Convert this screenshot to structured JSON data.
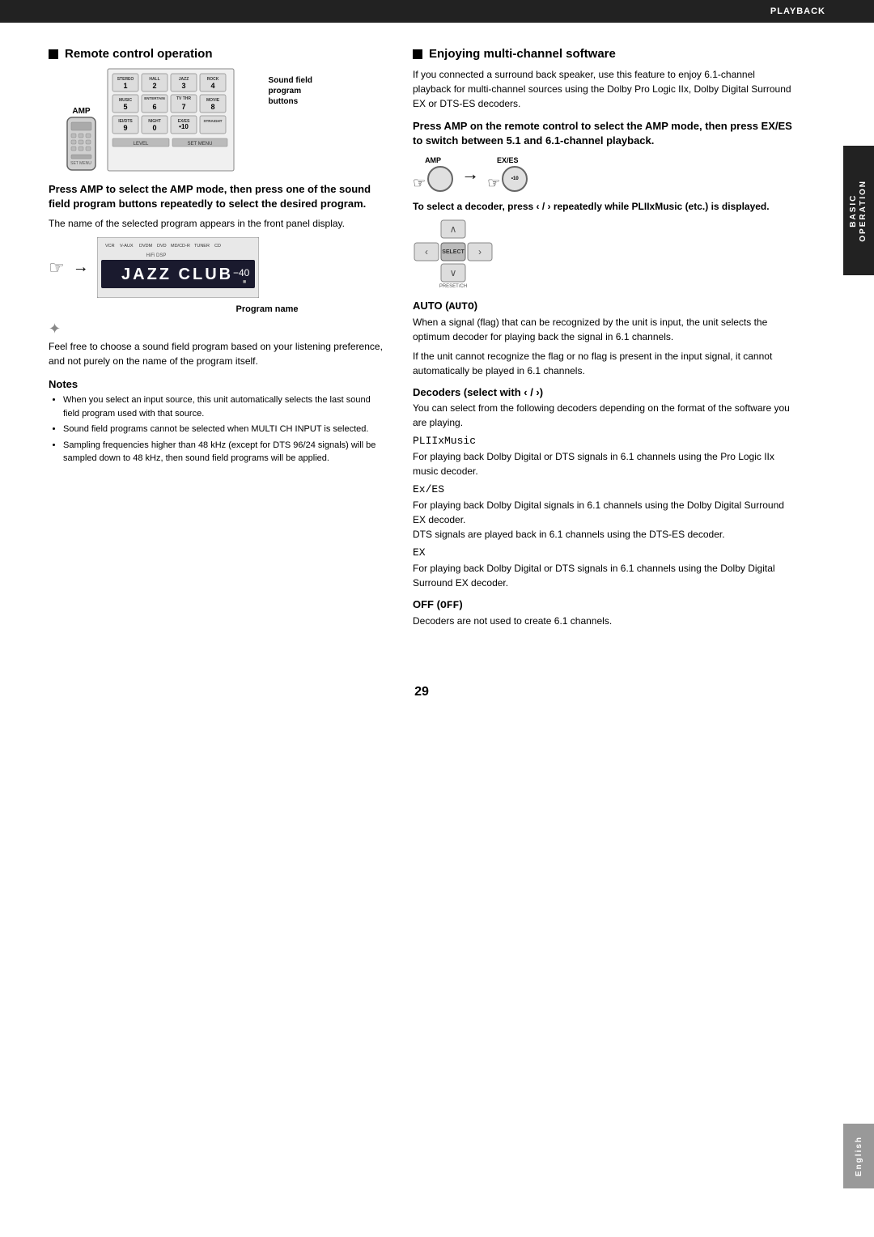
{
  "page": {
    "number": "29",
    "section_tab": "PLAYBACK",
    "right_tab_lines": [
      "BASIC",
      "OPERATION"
    ],
    "bottom_tab": "English"
  },
  "left_section": {
    "title": "Remote control operation",
    "amp_label": "AMP",
    "sound_field_label": "Sound field\nprogram\nbuttons",
    "instruction_bold": "Press AMP to select the AMP mode, then press one of the sound field program buttons repeatedly to select the desired program.",
    "instruction_para": "The name of the selected program appears in the front panel display.",
    "program_name_label": "Program name",
    "display_text": "JAZZ CLUB",
    "display_volume": "–40",
    "display_sources": [
      "VCR",
      "V-AUX",
      "DVDM",
      "DVD",
      "MD/CD-R",
      "TUNER",
      "CD"
    ],
    "display_hifi_dsp": "HiFi DSP",
    "tip_text": "Feel free to choose a sound field program based on your listening preference, and not purely on the name of the program itself.",
    "notes_header": "Notes",
    "notes_items": [
      "When you select an input source, this unit automatically selects the last sound field program used with that source.",
      "Sound field programs cannot be selected when MULTI CH INPUT is selected.",
      "Sampling frequencies higher than 48 kHz (except for DTS 96/24 signals) will be sampled down to 48 kHz, then sound field programs will be applied."
    ],
    "matrix_buttons": [
      {
        "label": "STEREO",
        "num": "1"
      },
      {
        "label": "HALL",
        "num": "2"
      },
      {
        "label": "JAZZ",
        "num": "3"
      },
      {
        "label": "ROCK",
        "num": "4"
      },
      {
        "label": "MUSIC",
        "num": "5"
      },
      {
        "label": "ENTERTAIN",
        "num": "6"
      },
      {
        "label": "TV THR",
        "num": "7"
      },
      {
        "label": "MOVIE",
        "num": "8"
      },
      {
        "label": "IEI/DTS",
        "num": "9"
      },
      {
        "label": "NIGHT",
        "num": "0"
      },
      {
        "label": "EX/ES",
        "num": "•10"
      },
      {
        "label": "STRAIGHT",
        "num": ""
      }
    ]
  },
  "right_section": {
    "title": "Enjoying multi-channel software",
    "intro_para": "If you connected a surround back speaker, use this feature to enjoy 6.1-channel playback for multi-channel sources using the Dolby Pro Logic IIx, Dolby Digital Surround EX or DTS-ES decoders.",
    "instruction_bold": "Press AMP on the remote control to select the AMP mode, then press EX/ES to switch between 5.1 and 6.1-channel playback.",
    "amp_button_label": "AMP",
    "exes_button_label": "EX/ES\n•10",
    "decoder_press_text": "To select a decoder, press ‹ / › repeatedly while PLIIxMusic (etc.) is displayed.",
    "auto_header": "AUTO (AUTO)",
    "auto_para1": "When a signal (flag) that can be recognized by the unit is input, the unit selects the optimum decoder for playing back the signal in 6.1 channels.",
    "auto_para2": "If the unit cannot recognize the flag or no flag is present in the input signal, it cannot automatically be played in 6.1 channels.",
    "decoders_header": "Decoders (select with ‹ / ›)",
    "plii_mono": "PLIIxMusic",
    "plii_desc": "For playing back Dolby Digital or DTS signals in 6.1 channels using the Pro Logic IIx music decoder.",
    "exes_mono": "Ex/ES",
    "exes_desc": "For playing back Dolby Digital signals in 6.1 channels using the Dolby Digital Surround EX decoder.\nDTS signals are played back in 6.1 channels using the DTS-ES decoder.",
    "ex_mono": "EX",
    "ex_desc": "For playing back Dolby Digital or DTS signals in 6.1 channels using the Dolby Digital Surround EX decoder.",
    "off_header": "OFF (OFF)",
    "off_desc": "Decoders are not used to create 6.1 channels."
  }
}
